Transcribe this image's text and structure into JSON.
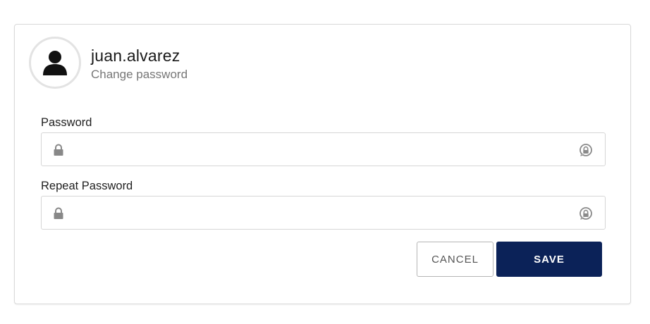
{
  "user": {
    "username": "juan.alvarez",
    "subtitle": "Change password",
    "avatar_icon": "user-silhouette-icon"
  },
  "form": {
    "password": {
      "label": "Password",
      "value": "",
      "placeholder": "",
      "lead_icon": "lock-icon",
      "trail_icon": "reveal-password-icon"
    },
    "repeat_password": {
      "label": "Repeat Password",
      "value": "",
      "placeholder": "",
      "lead_icon": "lock-icon",
      "trail_icon": "reveal-password-icon"
    }
  },
  "actions": {
    "cancel_label": "CANCEL",
    "save_label": "SAVE"
  },
  "colors": {
    "primary": "#0b2258",
    "border": "#d6d6d6",
    "icon": "#888888",
    "subtitle": "#777777"
  }
}
